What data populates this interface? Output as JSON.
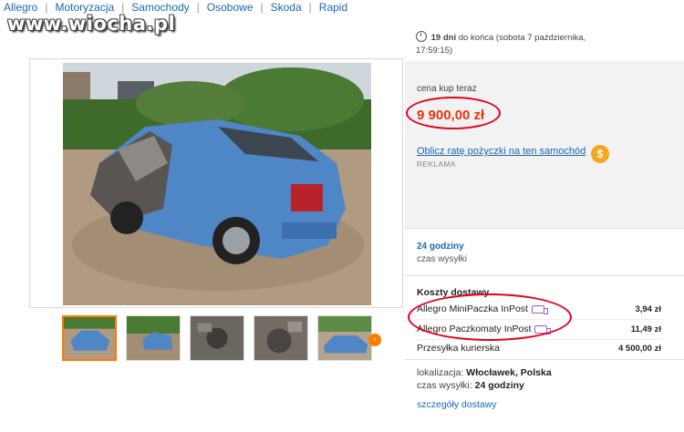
{
  "breadcrumb": [
    "Allegro",
    "Motoryzacja",
    "Samochody",
    "Osobowe",
    "Skoda",
    "Rapid"
  ],
  "watermark": "www.wiocha.pl",
  "timer": {
    "days": "19 dni",
    "rest": "do końca (sobota 7 października,",
    "time": "17:59:15)"
  },
  "price": {
    "label": "cena kup teraz",
    "value": "9 900,00 zł"
  },
  "loan": {
    "link": "Oblicz ratę pożyczki na ten samochód",
    "icon": "$",
    "ad_label": "REKLAMA"
  },
  "shipping": {
    "time": "24 godziny",
    "time_label": "czas wysyłki"
  },
  "delivery": {
    "title": "Koszty dostawy",
    "options": [
      {
        "name": "Allegro MiniPaczka InPost",
        "amount": "3,94 zł",
        "icon": "truck-icon"
      },
      {
        "name": "Allegro Paczkomaty InPost",
        "amount": "11,49 zł",
        "icon": "truck-icon"
      },
      {
        "name": "Przesyłka kurierska",
        "amount": "4 500,00 zł"
      }
    ]
  },
  "location": {
    "label": "lokalizacja:",
    "value": "Włocławek, Polska",
    "ship_label": "czas wysyłki:",
    "ship_value": "24 godziny"
  },
  "details_link": "szczegóły dostawy",
  "thumbnails": {
    "count": 5,
    "active_index": 0,
    "next_icon": "›"
  },
  "colors": {
    "link": "#1a66b3",
    "price": "#e8330d",
    "annotation": "#e4001b",
    "accent": "#ff7a00"
  }
}
